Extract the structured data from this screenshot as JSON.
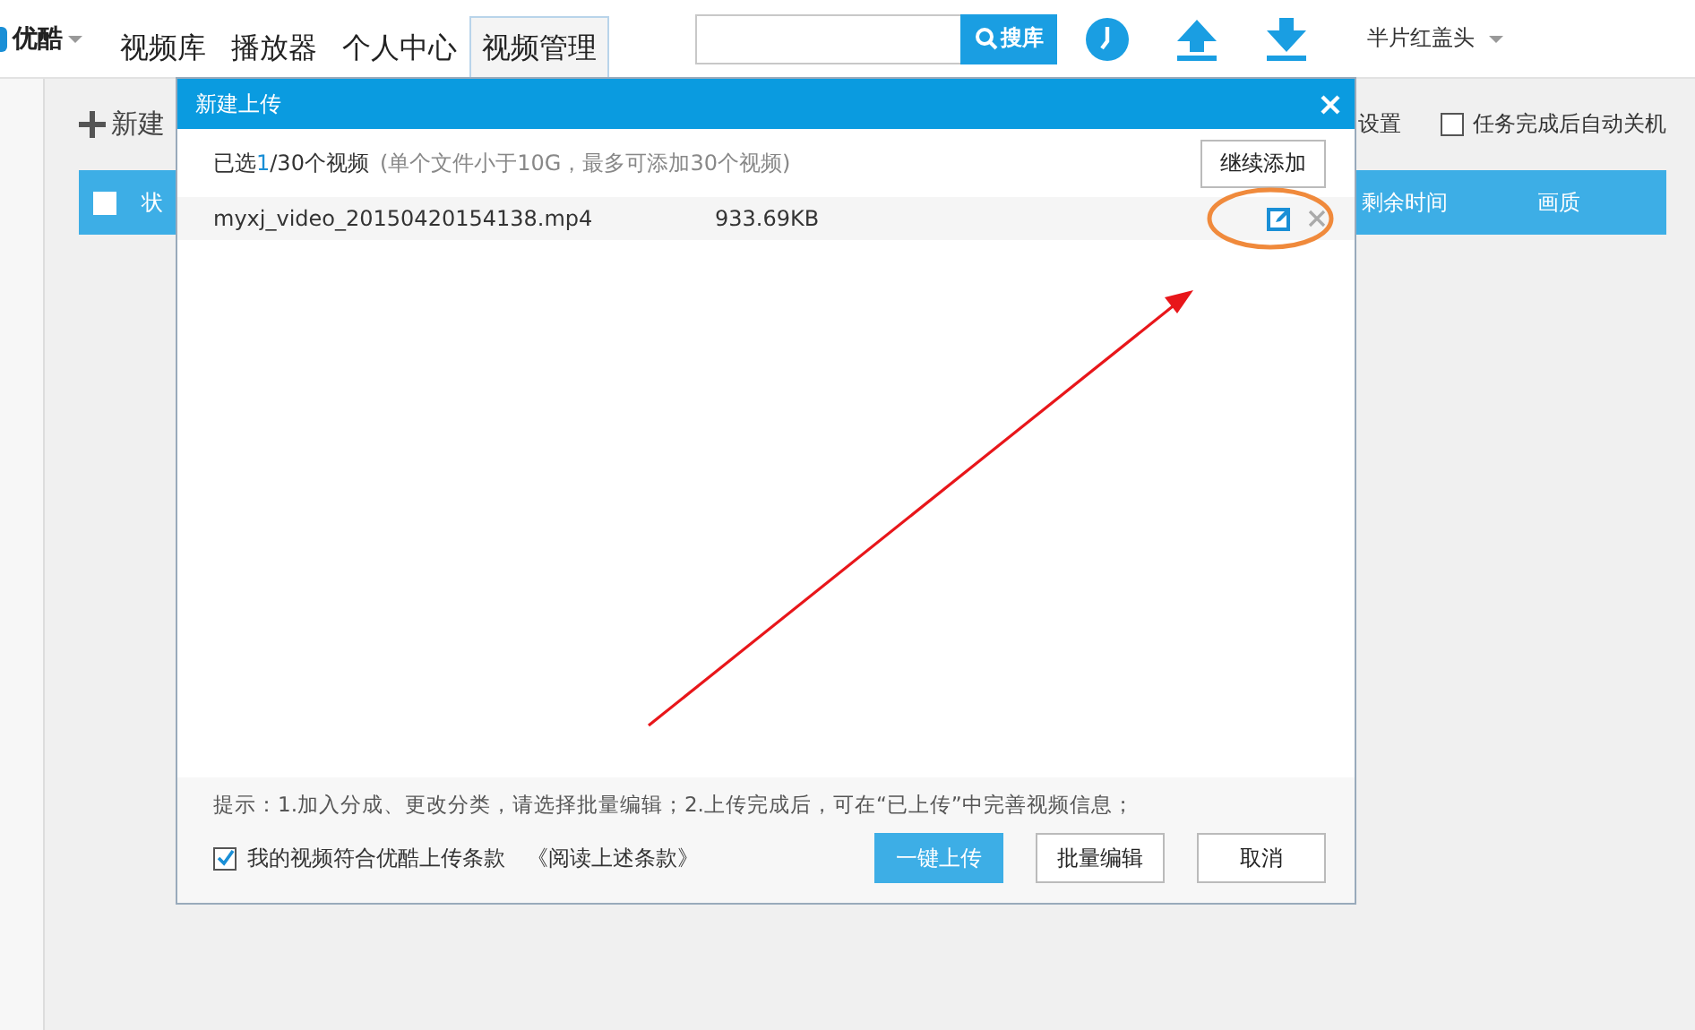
{
  "app": {
    "logo": "优酷"
  },
  "nav": [
    {
      "label": "视频库",
      "selected": false
    },
    {
      "label": "播放器",
      "selected": false
    },
    {
      "label": "个人中心",
      "selected": false
    },
    {
      "label": "视频管理",
      "selected": true
    }
  ],
  "search": {
    "button": "搜库"
  },
  "user": {
    "name": "半片红盖头"
  },
  "toolbar": {
    "new_button": "新建",
    "settings": "设置",
    "auto_shutdown": {
      "label": "任务完成后自动关机",
      "checked": false
    }
  },
  "table": {
    "select_all": {
      "checked": false
    },
    "columns": [
      "状",
      "剩余时间",
      "画质"
    ]
  },
  "dialog": {
    "title": "新建上传",
    "summary": {
      "before": "已选",
      "count": "1",
      "after": "/30个视频"
    },
    "note": "(单个文件小于10G，最多可添加30个视频)",
    "add_button": "继续添加",
    "files": [
      {
        "name": "myxj_video_20150420154138.mp4",
        "size": "933.69KB"
      }
    ],
    "tip": "提示：1.加入分成、更改分类，请选择批量编辑；2.上传完成后，可在“已上传”中完善视频信息；",
    "agree": {
      "label": "我的视频符合优酷上传条款",
      "checked": true
    },
    "terms_link": "《阅读上述条款》",
    "buttons": [
      {
        "label": "一键上传",
        "primary": true
      },
      {
        "label": "批量编辑",
        "primary": false
      },
      {
        "label": "取消",
        "primary": false
      }
    ]
  }
}
